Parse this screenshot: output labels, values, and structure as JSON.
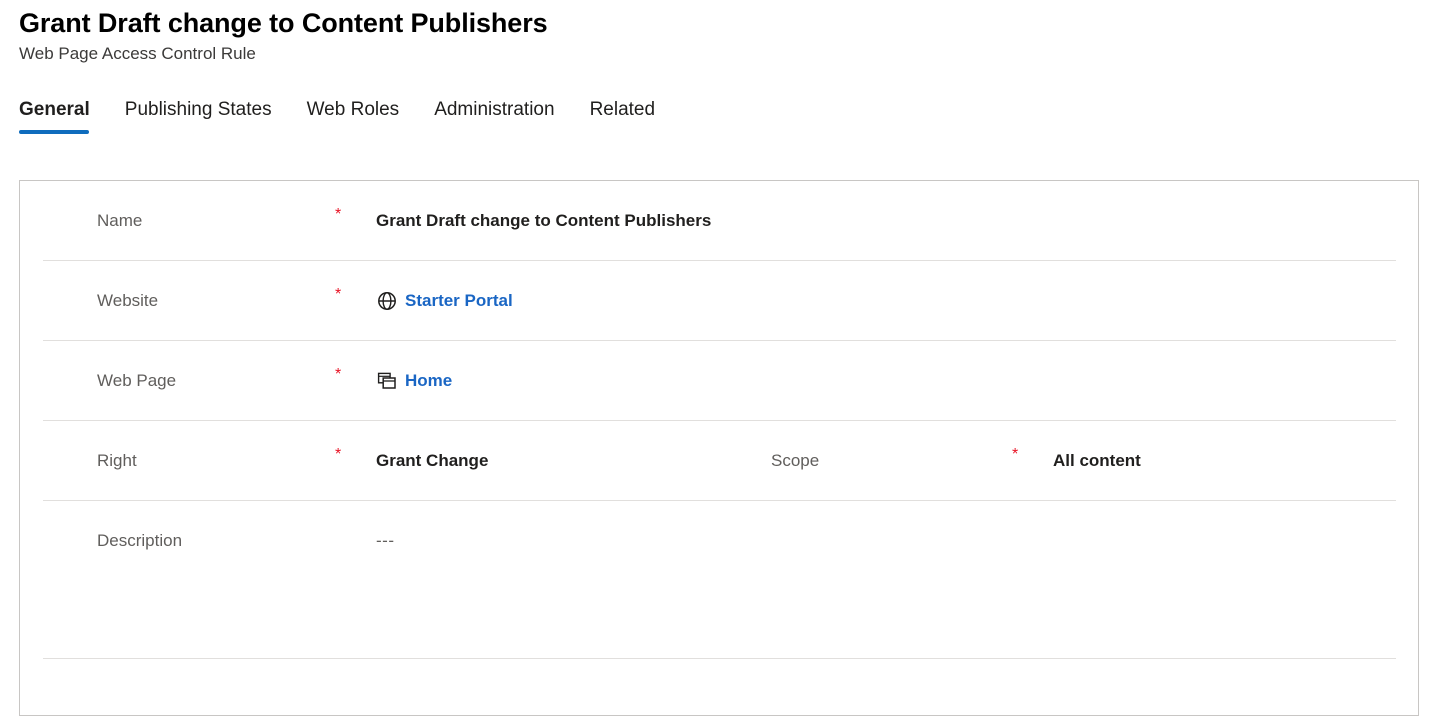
{
  "header": {
    "title": "Grant Draft change to Content Publishers",
    "subtitle": "Web Page Access Control Rule"
  },
  "tabs": [
    {
      "label": "General",
      "selected": true
    },
    {
      "label": "Publishing States",
      "selected": false
    },
    {
      "label": "Web Roles",
      "selected": false
    },
    {
      "label": "Administration",
      "selected": false
    },
    {
      "label": "Related",
      "selected": false
    }
  ],
  "colors": {
    "accent": "#0f6cbd",
    "link": "#1a66c4",
    "required_star": "#e81123",
    "label": "#605e5c",
    "border": "#c8c6c4",
    "divider": "#e1dfdd"
  },
  "form": {
    "required_marker": "*",
    "rows": [
      {
        "label": "Name",
        "required": true,
        "value": "Grant Draft change to Content Publishers",
        "icon": null,
        "is_link": false
      },
      {
        "label": "Website",
        "required": true,
        "value": "Starter Portal",
        "icon": "globe-icon",
        "is_link": true
      },
      {
        "label": "Web Page",
        "required": true,
        "value": "Home",
        "icon": "web-page-icon",
        "is_link": true
      },
      {
        "label": "Right",
        "required": true,
        "value": "Grant Change",
        "icon": null,
        "is_link": false,
        "second": {
          "label": "Scope",
          "required": true,
          "value": "All content"
        }
      },
      {
        "label": "Description",
        "required": false,
        "value": "---",
        "icon": null,
        "is_link": false
      }
    ]
  }
}
